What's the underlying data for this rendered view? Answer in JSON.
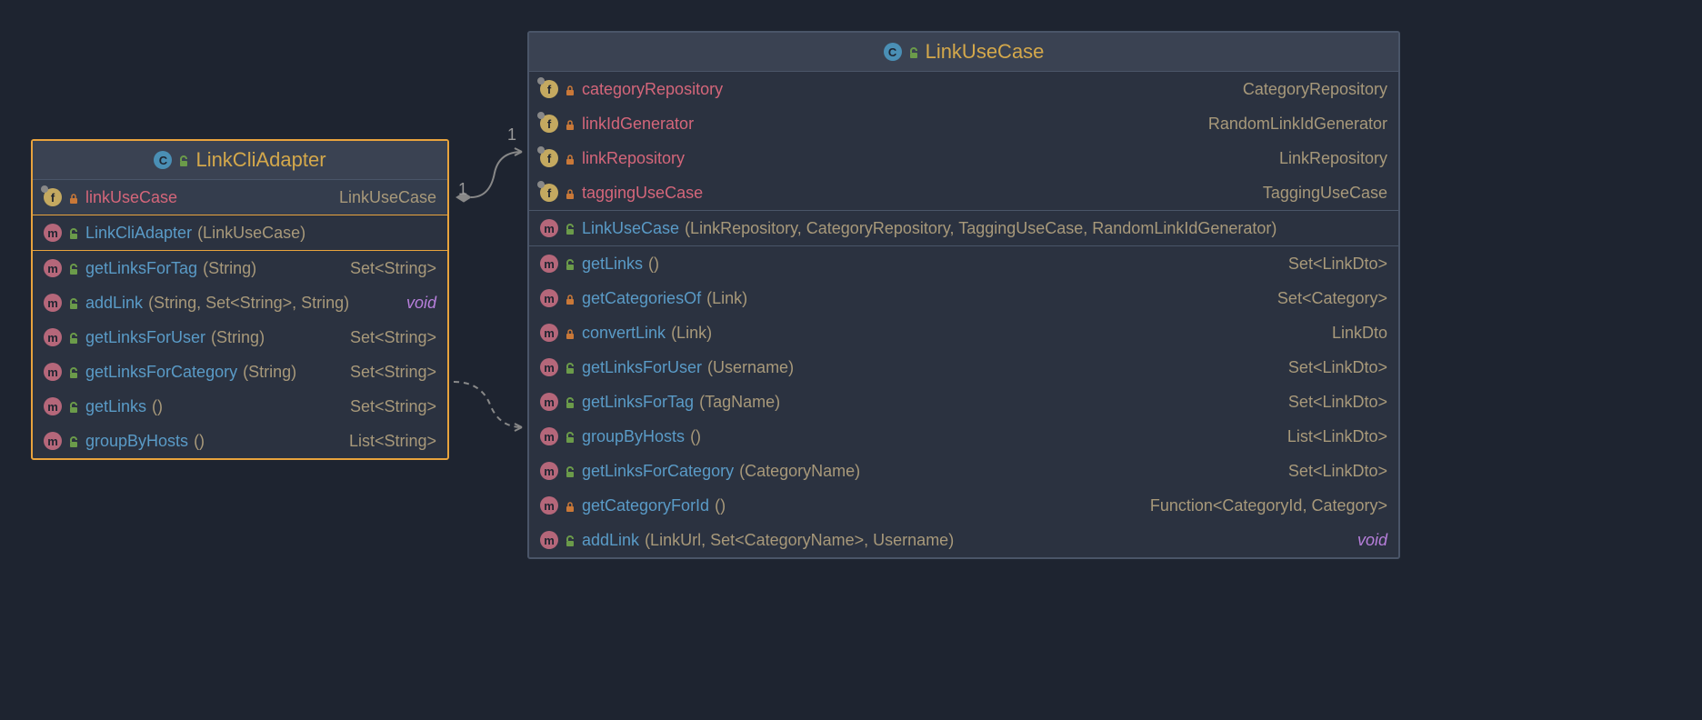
{
  "classes": {
    "linkCliAdapter": {
      "name": "LinkCliAdapter",
      "fields": [
        {
          "name": "linkUseCase",
          "type": "LinkUseCase",
          "visibility": "private",
          "final": true
        }
      ],
      "constructors": [
        {
          "name": "LinkCliAdapter",
          "params": "(LinkUseCase)",
          "visibility": "public"
        }
      ],
      "methods": [
        {
          "name": "getLinksForTag",
          "params": "(String)",
          "return": "Set<String>",
          "visibility": "public"
        },
        {
          "name": "addLink",
          "params": "(String, Set<String>, String)",
          "return": "void",
          "visibility": "public"
        },
        {
          "name": "getLinksForUser",
          "params": "(String)",
          "return": "Set<String>",
          "visibility": "public"
        },
        {
          "name": "getLinksForCategory",
          "params": "(String)",
          "return": "Set<String>",
          "visibility": "public"
        },
        {
          "name": "getLinks",
          "params": "()",
          "return": "Set<String>",
          "visibility": "public"
        },
        {
          "name": "groupByHosts",
          "params": "()",
          "return": "List<String>",
          "visibility": "public"
        }
      ]
    },
    "linkUseCase": {
      "name": "LinkUseCase",
      "fields": [
        {
          "name": "categoryRepository",
          "type": "CategoryRepository",
          "visibility": "private",
          "final": true
        },
        {
          "name": "linkIdGenerator",
          "type": "RandomLinkIdGenerator",
          "visibility": "private",
          "final": true
        },
        {
          "name": "linkRepository",
          "type": "LinkRepository",
          "visibility": "private",
          "final": true
        },
        {
          "name": "taggingUseCase",
          "type": "TaggingUseCase",
          "visibility": "private",
          "final": true
        }
      ],
      "constructors": [
        {
          "name": "LinkUseCase",
          "params": "(LinkRepository, CategoryRepository, TaggingUseCase, RandomLinkIdGenerator)",
          "visibility": "public"
        }
      ],
      "methods": [
        {
          "name": "getLinks",
          "params": "()",
          "return": "Set<LinkDto>",
          "visibility": "public"
        },
        {
          "name": "getCategoriesOf",
          "params": "(Link)",
          "return": "Set<Category>",
          "visibility": "private"
        },
        {
          "name": "convertLink",
          "params": "(Link)",
          "return": "LinkDto",
          "visibility": "private"
        },
        {
          "name": "getLinksForUser",
          "params": "(Username)",
          "return": "Set<LinkDto>",
          "visibility": "public"
        },
        {
          "name": "getLinksForTag",
          "params": "(TagName)",
          "return": "Set<LinkDto>",
          "visibility": "public"
        },
        {
          "name": "groupByHosts",
          "params": "()",
          "return": "List<LinkDto>",
          "visibility": "public"
        },
        {
          "name": "getLinksForCategory",
          "params": "(CategoryName)",
          "return": "Set<LinkDto>",
          "visibility": "public"
        },
        {
          "name": "getCategoryForId",
          "params": "()",
          "return": "Function<CategoryId, Category>",
          "visibility": "private"
        },
        {
          "name": "addLink",
          "params": "(LinkUrl, Set<CategoryName>, Username)",
          "return": "void",
          "visibility": "public"
        }
      ]
    }
  },
  "relationships": {
    "composition": {
      "from": "linkCliAdapter",
      "to": "linkUseCase",
      "multiplicity_from": "1",
      "multiplicity_to": "1"
    },
    "dependency": {
      "from": "linkCliAdapter",
      "to": "linkUseCase"
    }
  }
}
